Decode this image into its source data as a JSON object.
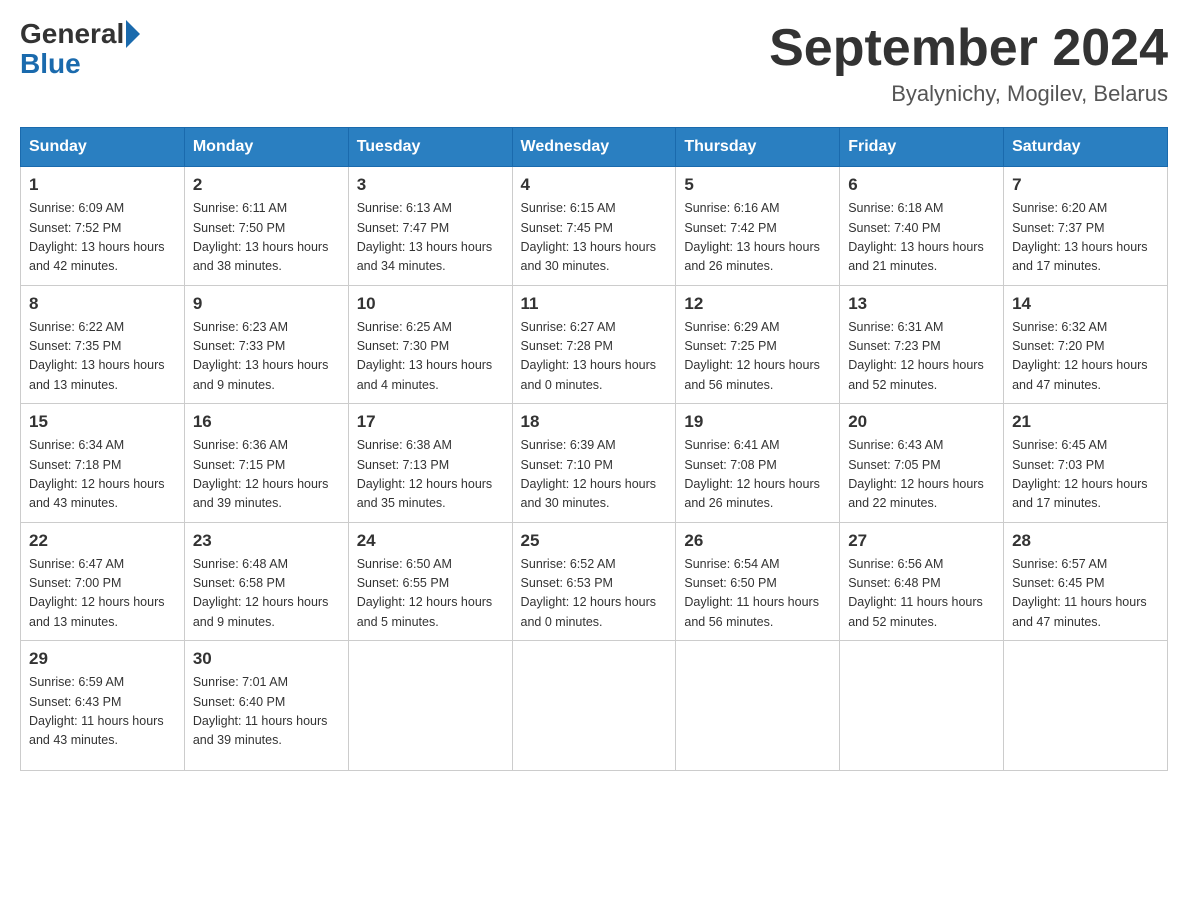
{
  "header": {
    "logo_general": "General",
    "logo_blue": "Blue",
    "title": "September 2024",
    "subtitle": "Byalynichy, Mogilev, Belarus"
  },
  "days_of_week": [
    "Sunday",
    "Monday",
    "Tuesday",
    "Wednesday",
    "Thursday",
    "Friday",
    "Saturday"
  ],
  "weeks": [
    [
      {
        "day": "1",
        "sunrise": "6:09 AM",
        "sunset": "7:52 PM",
        "daylight": "13 hours and 42 minutes."
      },
      {
        "day": "2",
        "sunrise": "6:11 AM",
        "sunset": "7:50 PM",
        "daylight": "13 hours and 38 minutes."
      },
      {
        "day": "3",
        "sunrise": "6:13 AM",
        "sunset": "7:47 PM",
        "daylight": "13 hours and 34 minutes."
      },
      {
        "day": "4",
        "sunrise": "6:15 AM",
        "sunset": "7:45 PM",
        "daylight": "13 hours and 30 minutes."
      },
      {
        "day": "5",
        "sunrise": "6:16 AM",
        "sunset": "7:42 PM",
        "daylight": "13 hours and 26 minutes."
      },
      {
        "day": "6",
        "sunrise": "6:18 AM",
        "sunset": "7:40 PM",
        "daylight": "13 hours and 21 minutes."
      },
      {
        "day": "7",
        "sunrise": "6:20 AM",
        "sunset": "7:37 PM",
        "daylight": "13 hours and 17 minutes."
      }
    ],
    [
      {
        "day": "8",
        "sunrise": "6:22 AM",
        "sunset": "7:35 PM",
        "daylight": "13 hours and 13 minutes."
      },
      {
        "day": "9",
        "sunrise": "6:23 AM",
        "sunset": "7:33 PM",
        "daylight": "13 hours and 9 minutes."
      },
      {
        "day": "10",
        "sunrise": "6:25 AM",
        "sunset": "7:30 PM",
        "daylight": "13 hours and 4 minutes."
      },
      {
        "day": "11",
        "sunrise": "6:27 AM",
        "sunset": "7:28 PM",
        "daylight": "13 hours and 0 minutes."
      },
      {
        "day": "12",
        "sunrise": "6:29 AM",
        "sunset": "7:25 PM",
        "daylight": "12 hours and 56 minutes."
      },
      {
        "day": "13",
        "sunrise": "6:31 AM",
        "sunset": "7:23 PM",
        "daylight": "12 hours and 52 minutes."
      },
      {
        "day": "14",
        "sunrise": "6:32 AM",
        "sunset": "7:20 PM",
        "daylight": "12 hours and 47 minutes."
      }
    ],
    [
      {
        "day": "15",
        "sunrise": "6:34 AM",
        "sunset": "7:18 PM",
        "daylight": "12 hours and 43 minutes."
      },
      {
        "day": "16",
        "sunrise": "6:36 AM",
        "sunset": "7:15 PM",
        "daylight": "12 hours and 39 minutes."
      },
      {
        "day": "17",
        "sunrise": "6:38 AM",
        "sunset": "7:13 PM",
        "daylight": "12 hours and 35 minutes."
      },
      {
        "day": "18",
        "sunrise": "6:39 AM",
        "sunset": "7:10 PM",
        "daylight": "12 hours and 30 minutes."
      },
      {
        "day": "19",
        "sunrise": "6:41 AM",
        "sunset": "7:08 PM",
        "daylight": "12 hours and 26 minutes."
      },
      {
        "day": "20",
        "sunrise": "6:43 AM",
        "sunset": "7:05 PM",
        "daylight": "12 hours and 22 minutes."
      },
      {
        "day": "21",
        "sunrise": "6:45 AM",
        "sunset": "7:03 PM",
        "daylight": "12 hours and 17 minutes."
      }
    ],
    [
      {
        "day": "22",
        "sunrise": "6:47 AM",
        "sunset": "7:00 PM",
        "daylight": "12 hours and 13 minutes."
      },
      {
        "day": "23",
        "sunrise": "6:48 AM",
        "sunset": "6:58 PM",
        "daylight": "12 hours and 9 minutes."
      },
      {
        "day": "24",
        "sunrise": "6:50 AM",
        "sunset": "6:55 PM",
        "daylight": "12 hours and 5 minutes."
      },
      {
        "day": "25",
        "sunrise": "6:52 AM",
        "sunset": "6:53 PM",
        "daylight": "12 hours and 0 minutes."
      },
      {
        "day": "26",
        "sunrise": "6:54 AM",
        "sunset": "6:50 PM",
        "daylight": "11 hours and 56 minutes."
      },
      {
        "day": "27",
        "sunrise": "6:56 AM",
        "sunset": "6:48 PM",
        "daylight": "11 hours and 52 minutes."
      },
      {
        "day": "28",
        "sunrise": "6:57 AM",
        "sunset": "6:45 PM",
        "daylight": "11 hours and 47 minutes."
      }
    ],
    [
      {
        "day": "29",
        "sunrise": "6:59 AM",
        "sunset": "6:43 PM",
        "daylight": "11 hours and 43 minutes."
      },
      {
        "day": "30",
        "sunrise": "7:01 AM",
        "sunset": "6:40 PM",
        "daylight": "11 hours and 39 minutes."
      },
      null,
      null,
      null,
      null,
      null
    ]
  ],
  "labels": {
    "sunrise": "Sunrise:",
    "sunset": "Sunset:",
    "daylight": "Daylight:"
  }
}
